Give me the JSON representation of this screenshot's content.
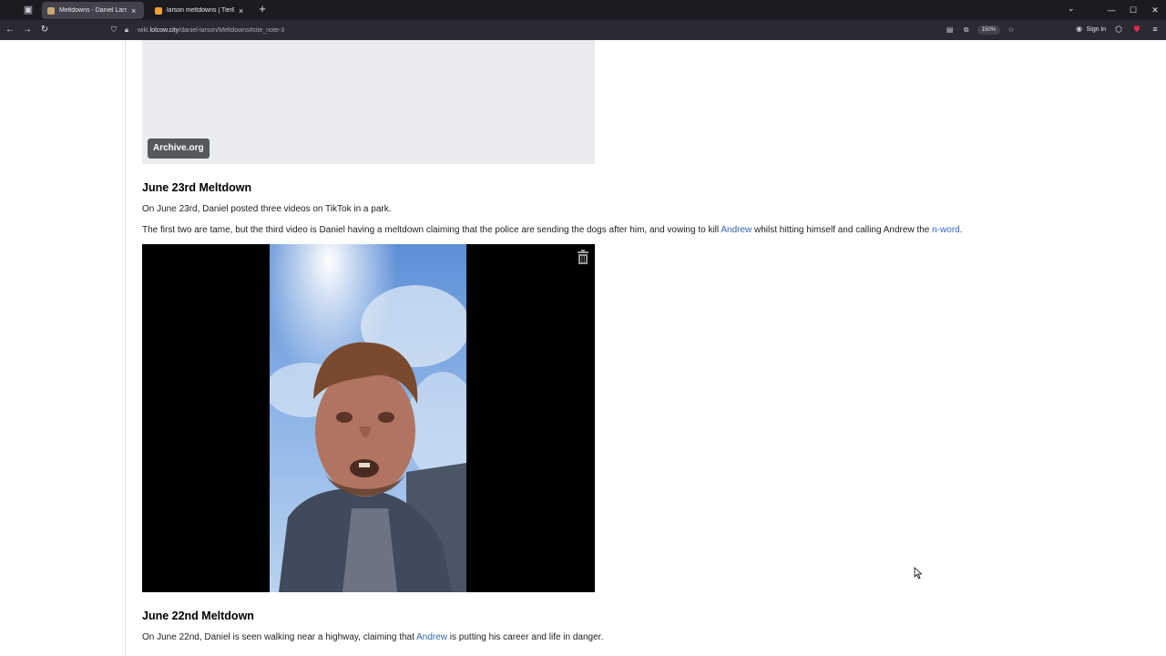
{
  "browser": {
    "tabs": [
      {
        "title": "Meltdowns - Daniel Larson Wi",
        "active": true,
        "favicon_color": "#c9a96e"
      },
      {
        "title": "larson meltdowns | TierBuddy",
        "active": false,
        "favicon_color": "#f0a030"
      }
    ],
    "new_tab_icon": "plus-icon",
    "url": {
      "prefix": "wiki.",
      "host": "lolcow.city",
      "path": "/daniel-larson/Meltdowns#cite_note-3"
    },
    "zoom": "150%",
    "signin_label": "Sign in"
  },
  "page": {
    "archive_badge": "Archive.org",
    "sections": [
      {
        "heading": "June 23rd Meltdown",
        "para1": "On June 23rd, Daniel posted three videos on TikTok in a park.",
        "para2_before": "The first two are tame, but the third video is Daniel having a meltdown claiming that the police are sending the dogs after him, and vowing to kill ",
        "para2_link1": "Andrew",
        "para2_middle": " whilst hitting himself and calling Andrew the ",
        "para2_link2": "n-word",
        "para2_after": "."
      },
      {
        "heading": "June 22nd Meltdown",
        "para1_before": "On June 22nd, Daniel is seen walking near a highway, claiming that ",
        "para1_link": "Andrew",
        "para1_after": " is putting his career and life in danger."
      }
    ]
  },
  "colors": {
    "link": "#3366aa",
    "placeholder_bg": "#eaecf0",
    "badge_bg": "#54595d"
  }
}
